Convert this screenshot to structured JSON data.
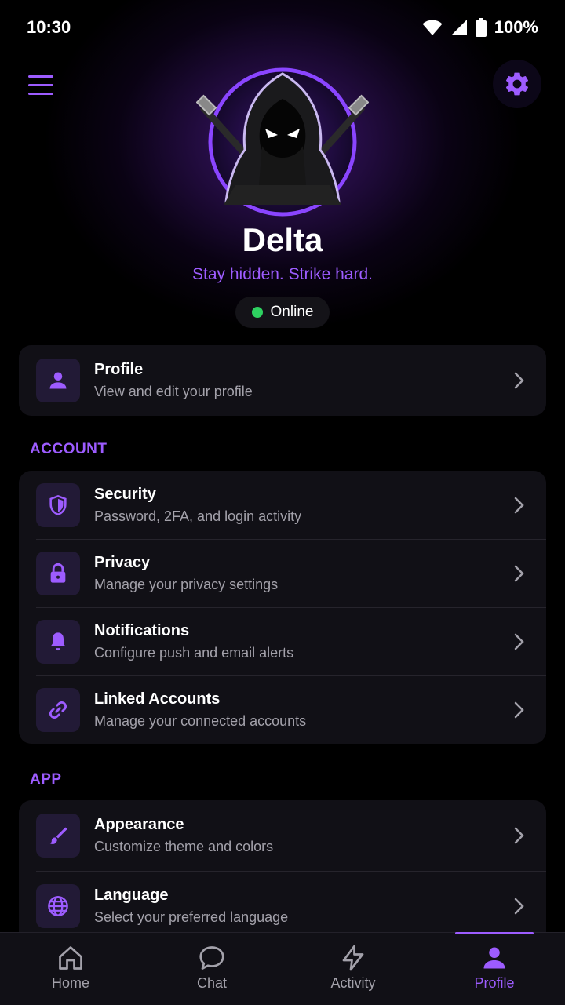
{
  "status_bar": {
    "time": "10:30",
    "battery": "100%"
  },
  "header": {
    "menu_icon": "hamburger-menu-icon",
    "settings_icon": "gear-icon"
  },
  "profile": {
    "name": "Delta",
    "tagline": "Stay hidden. Strike hard.",
    "status": "Online",
    "avatar": "hooded-ninja-avatar"
  },
  "profile_card": {
    "title": "Profile",
    "subtitle": "View and edit your profile",
    "icon": "person-icon"
  },
  "sections": {
    "account": {
      "label": "ACCOUNT",
      "items": [
        {
          "title": "Security",
          "subtitle": "Password, 2FA, and login activity",
          "icon": "shield-icon"
        },
        {
          "title": "Privacy",
          "subtitle": "Manage your privacy settings",
          "icon": "lock-icon"
        },
        {
          "title": "Notifications",
          "subtitle": "Configure push and email alerts",
          "icon": "bell-icon"
        },
        {
          "title": "Linked Accounts",
          "subtitle": "Manage your connected accounts",
          "icon": "link-icon"
        }
      ]
    },
    "app": {
      "label": "APP",
      "items": [
        {
          "title": "Appearance",
          "subtitle": "Customize theme and colors",
          "icon": "brush-icon"
        },
        {
          "title": "Language",
          "subtitle": "Select your preferred language",
          "icon": "globe-icon"
        }
      ]
    }
  },
  "bottom_nav": {
    "items": [
      {
        "label": "Home",
        "icon": "home-icon"
      },
      {
        "label": "Chat",
        "icon": "chat-bubble-icon"
      },
      {
        "label": "Activity",
        "icon": "lightning-icon"
      },
      {
        "label": "Profile",
        "icon": "person-icon"
      }
    ],
    "active": "Profile"
  },
  "colors": {
    "accent": "#9d5cff",
    "background": "#000000",
    "card": "#111016",
    "online": "#2ed160"
  }
}
